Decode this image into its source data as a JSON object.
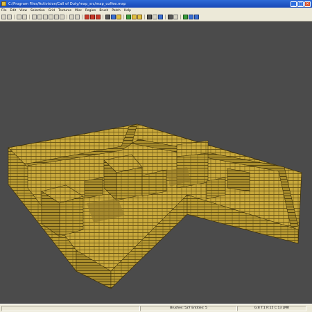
{
  "window": {
    "title": "C:/Program Files/Activision/Call of Duty/map_src/map_coffee.map",
    "app_icon": "radiant-icon",
    "minimize_glyph": "_",
    "maximize_glyph": "□",
    "close_glyph": "×"
  },
  "menu": [
    "File",
    "Edit",
    "View",
    "Selection",
    "Grid",
    "Textures",
    "Misc",
    "Region",
    "Brush",
    "Patch",
    "Help"
  ],
  "toolbar": {
    "icons": [
      "open-icon",
      "save-icon",
      "sep",
      "undo-icon",
      "redo-icon",
      "sep",
      "flip-x-icon",
      "flip-y-icon",
      "flip-z-icon",
      "rotate-x-icon",
      "rotate-y-icon",
      "rotate-z-icon",
      "sep",
      "select-icon",
      "drag-icon",
      "sep",
      "csg-subtract-icon",
      "csg-merge-icon",
      "hollow-icon",
      "sep",
      "clipper-icon",
      "camera-icon",
      "texture-icon",
      "sep",
      "entity-icon",
      "brush-icon",
      "patch-icon",
      "sep",
      "lock-icon",
      "scale-icon",
      "view-icon",
      "sep",
      "cubic-clip-icon",
      "grid-icon",
      "sep",
      "lights-icon",
      "fog-icon",
      "sky-icon"
    ]
  },
  "colors": {
    "viewport_bg": "#4b4b4b",
    "geometry_top": "#c8a83c",
    "geometry_side": "#b39530",
    "geometry_line": "#5a4810",
    "accent": "#1747b7"
  },
  "statusbar": {
    "brushes": "Brushes: 527 Entities: 5",
    "grid": "G:8 T:1 R:15 C:13 LMR"
  }
}
